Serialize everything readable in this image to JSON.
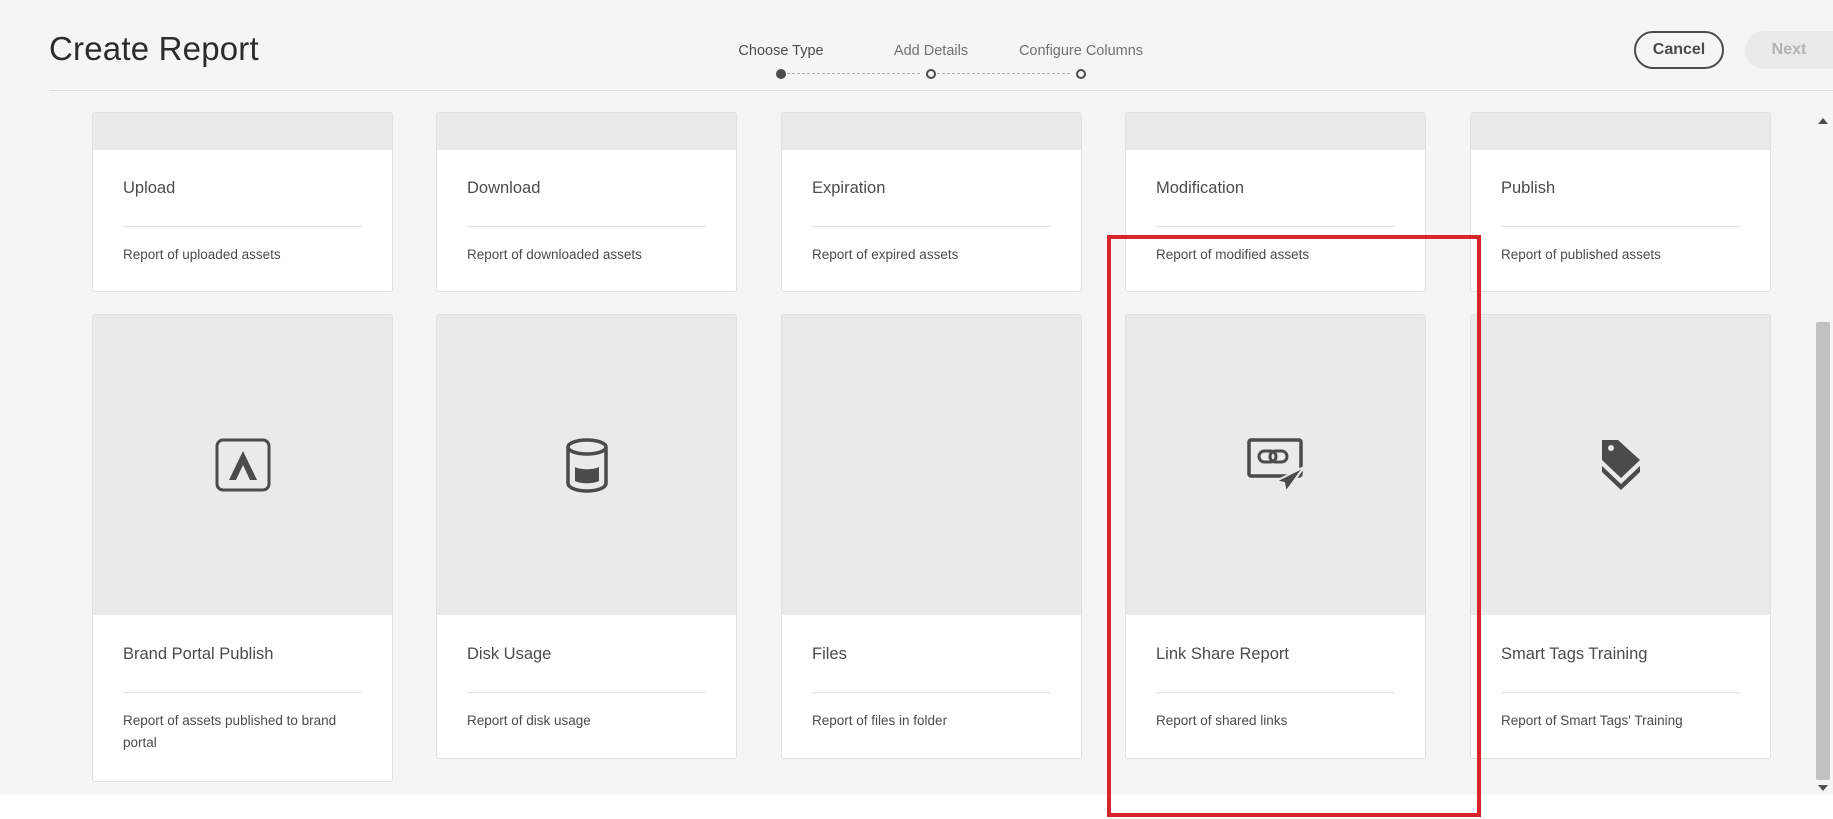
{
  "header": {
    "title": "Create Report",
    "steps": [
      {
        "label": "Choose Type"
      },
      {
        "label": "Add Details"
      },
      {
        "label": "Configure Columns"
      }
    ],
    "cancel_label": "Cancel",
    "next_label": "Next"
  },
  "cards": [
    {
      "title": "Upload",
      "description": "Report of uploaded assets"
    },
    {
      "title": "Download",
      "description": "Report of downloaded assets"
    },
    {
      "title": "Expiration",
      "description": "Report of expired assets"
    },
    {
      "title": "Modification",
      "description": "Report of modified assets"
    },
    {
      "title": "Publish",
      "description": "Report of published assets"
    },
    {
      "title": "Brand Portal Publish",
      "description": "Report of assets published to brand portal",
      "icon": "adobe-logo-icon"
    },
    {
      "title": "Disk Usage",
      "description": "Report of disk usage",
      "icon": "database-icon"
    },
    {
      "title": "Files",
      "description": "Report of files in folder"
    },
    {
      "title": "Link Share Report",
      "description": "Report of shared links",
      "icon": "link-share-icon"
    },
    {
      "title": "Smart Tags Training",
      "description": "Report of Smart Tags' Training",
      "icon": "tags-icon"
    }
  ],
  "colors": {
    "background": "#f5f5f5",
    "thumbnail": "#eaeaea",
    "text": "#4b4b4b",
    "highlight": "#d7252a",
    "disabled_button": "#eaeaea"
  }
}
